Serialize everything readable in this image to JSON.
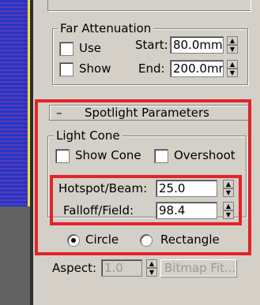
{
  "far_attenuation": {
    "title": "Far Attenuation",
    "use_label": "Use",
    "show_label": "Show",
    "start_label": "Start:",
    "start_value": "80.0mm",
    "end_label": "End:",
    "end_value": "200.0mr"
  },
  "spotlight": {
    "collapse_symbol": "–",
    "title": "Spotlight Parameters",
    "light_cone_title": "Light Cone",
    "show_cone_label": "Show Cone",
    "overshoot_label": "Overshoot",
    "hotspot_label": "Hotspot/Beam:",
    "hotspot_value": "25.0",
    "falloff_label": "Falloff/Field:",
    "falloff_value": "98.4",
    "circle_label": "Circle",
    "rectangle_label": "Rectangle",
    "selected_shape": "Circle",
    "aspect_label": "Aspect:",
    "aspect_value": "1.0",
    "bitmap_fit_label": "Bitmap Fit..."
  },
  "icons": {
    "spin_up": "▲",
    "spin_down": "▼"
  },
  "colors": {
    "highlight": "#e3232a",
    "panel": "#d4d0c8",
    "viewport_blue": "#2130c8",
    "viewport_border": "#e7e24b"
  }
}
